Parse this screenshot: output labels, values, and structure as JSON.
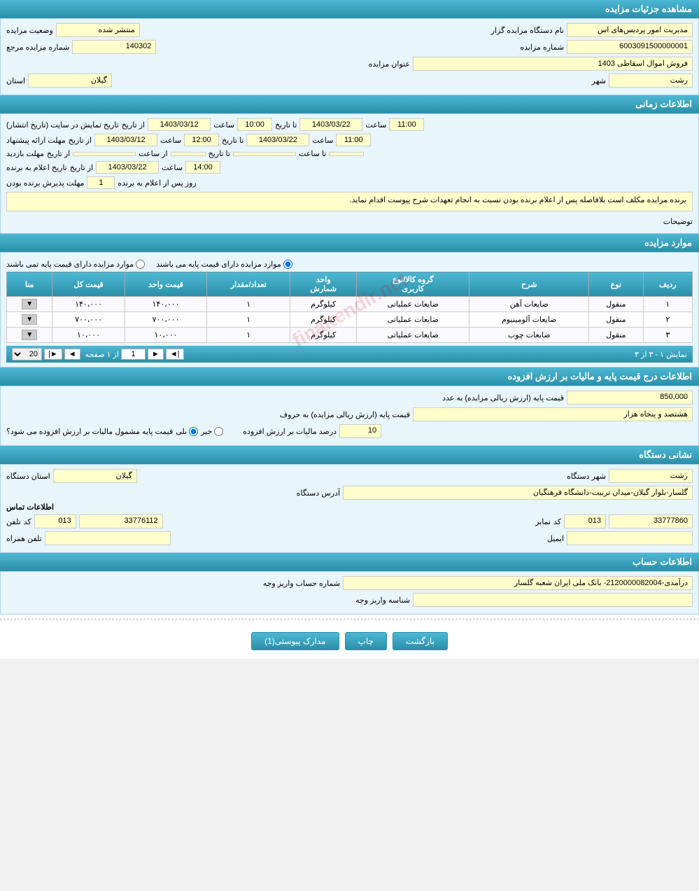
{
  "page": {
    "title": "مشاهده جزئیات مزایده"
  },
  "sections": {
    "auction_details": {
      "header": "مشاهده جزئیات مزایده",
      "fields": {
        "organizer_label": "نام دستگاه مزایده گزار",
        "organizer_value": "مدیریت امور پردیس‌های اس",
        "status_label": "وضعیت مزایده",
        "status_value": "منتشر شده",
        "auction_number_label": "شماره مزایده",
        "auction_number_value": "6003091500000001",
        "ref_number_label": "شماره مزایده مرجع",
        "ref_number_value": "140302",
        "title_label": "عنوان مزایده",
        "title_value": "فروش اموال اسقاطی 1403",
        "province_label": "استان",
        "province_value": "گیلان",
        "city_label": "شهر",
        "city_value": "رشت"
      }
    },
    "time_info": {
      "header": "اطلاعات زمانی",
      "display_label": "تاریخ نمایش در سایت (تاریخ انتشار)",
      "display_from_label": "از تاریخ",
      "display_from_date": "1403/03/12",
      "display_from_hour_label": "ساعت",
      "display_from_hour": "10:00",
      "display_to_label": "تا تاریخ",
      "display_to_date": "1403/03/22",
      "display_to_hour_label": "ساعت",
      "display_to_hour": "11:00",
      "offer_label": "مهلت ارائه پیشنهاد",
      "offer_from_label": "از تاریخ",
      "offer_from_date": "1403/03/12",
      "offer_from_hour_label": "ساعت",
      "offer_from_hour": "12:00",
      "offer_to_label": "تا تاریخ",
      "offer_to_date": "1403/03/22",
      "offer_to_hour_label": "ساعت",
      "offer_to_hour": "11:00",
      "visit_label": "مهلت بازدید",
      "visit_from_label": "از تاریخ",
      "visit_from_date": "",
      "visit_from_hour_label": "از ساعت",
      "visit_from_hour": "",
      "visit_to_label": "تا تاریخ",
      "visit_to_date": "",
      "visit_to_hour_label": "تا ساعت",
      "visit_to_hour": "",
      "winner_label": "تاریخ اعلام به برنده",
      "winner_from_label": "از تاریخ",
      "winner_from_date": "1403/03/22",
      "winner_from_hour_label": "ساعت",
      "winner_from_hour": "14:00",
      "accept_label": "مهلت پذیرش برنده بودن",
      "accept_days_label": "روز پس از اعلام به برنده",
      "accept_days": "1",
      "notes_label": "توضیحات",
      "notes_value": "برنده مزایده مکلف است بلافاصله پس از اعلام برنده بودن نسبت به انجام تعهدات شرح پیوست اقدام نماید."
    },
    "auction_items": {
      "header": "موارد مزایده",
      "radio_yes": "موارد مزایده دارای قیمت پایه می باشند",
      "radio_no": "موارد مزایده دارای قیمت پایه تمی باشند",
      "table": {
        "columns": [
          "ردیف",
          "نوع",
          "شرح",
          "گروه کالا/نوع کاربری",
          "واحد شمارش",
          "تعداد/مقدار",
          "قیمت واحد",
          "قیمت کل",
          "منا"
        ],
        "rows": [
          {
            "index": "١",
            "type": "منقول",
            "desc": "ضایعات آهن",
            "group": "ضایعات عملیاتی",
            "unit": "کیلوگرم",
            "qty": "١",
            "unit_price": "١۴۰،۰۰۰",
            "total": "١۴۰،۰۰۰",
            "extra": ""
          },
          {
            "index": "٢",
            "type": "منقول",
            "desc": "ضایعات آلومینیوم",
            "group": "ضایعات عملیاتی",
            "unit": "کیلوگرم",
            "qty": "١",
            "unit_price": "٧۰۰،۰۰۰",
            "total": "٧۰۰،۰۰۰",
            "extra": ""
          },
          {
            "index": "٣",
            "type": "منقول",
            "desc": "ضایعات چوب",
            "group": "ضایعات عملیاتی",
            "unit": "کیلوگرم",
            "qty": "١",
            "unit_price": "١۰،۰۰۰",
            "total": "١۰،۰۰۰",
            "extra": ""
          }
        ]
      },
      "pagination": {
        "showing": "نمایش ۱ - ۳ از ۳",
        "page_label": "صفحه",
        "of_label": "از ۱",
        "per_page": "20"
      }
    },
    "price_info": {
      "header": "اطلاعات درج قیمت پایه و مالیات بر ارزش افزوده",
      "base_price_label": "قیمت پایه (ارزش ریالی مزایده) به عدد",
      "base_price_value": "850,000",
      "base_price_text_label": "قیمت پایه (ارزش ریالی مزایده) به حروف",
      "base_price_text_value": "هشتصد و پنجاه هزار",
      "tax_question_label": "قیمت پایه مشمول مالیات بر ارزش افزوده می شود؟",
      "tax_yes": "بلی",
      "tax_no": "خیر",
      "tax_percent_label": "درصد مالیات بر ارزش افزوده",
      "tax_percent_value": "10"
    },
    "device_info": {
      "header": "نشانی دستگاه",
      "province_label": "استان دستگاه",
      "province_value": "گیلان",
      "city_label": "شهر دستگاه",
      "city_value": "رشت",
      "address_label": "آدرس دستگاه",
      "address_value": "گلسار-بلوار گیلان-میدان تربیت-دانشگاه فرهنگیان",
      "contact_label": "اطلاعات تماس",
      "phone_label": "تلفن",
      "phone_code_label": "کد",
      "phone_code": "013",
      "phone_value": "33776112",
      "fax_label": "نمابر",
      "fax_code_label": "کد",
      "fax_code": "013",
      "fax_value": "33777860",
      "mobile_label": "تلفن همراه",
      "mobile_value": "",
      "email_label": "ایمیل",
      "email_value": ""
    },
    "account_info": {
      "header": "اطلاعات حساب",
      "account_label": "شماره حساب واریز وجه",
      "account_value": "درآمدی-2120000082004- بانک ملی ایران شعبه گلسار",
      "sheba_label": "شناسه واریز وجه",
      "sheba_value": ""
    }
  },
  "buttons": {
    "documents": "مدارک پیوستی(1)",
    "print": "چاپ",
    "back": "بازگشت"
  }
}
